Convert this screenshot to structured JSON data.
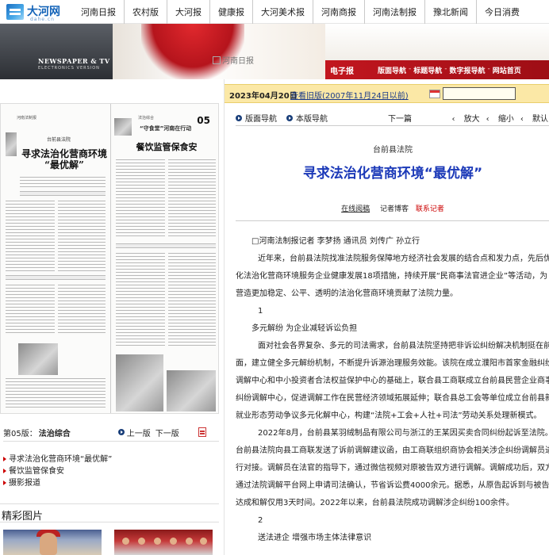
{
  "logo": {
    "name": "大河网",
    "sub": "dahe.cn"
  },
  "nav": [
    "河南日报",
    "农村版",
    "大河报",
    "健康报",
    "大河美术报",
    "河南商报",
    "河南法制报",
    "豫北新闻",
    "今日消费"
  ],
  "banner": {
    "title": "NEWSPAPER & TV",
    "subtitle": "ELECTRONICS VERSION",
    "flash_alt": "河南日报",
    "e_paper_label": "电子报",
    "links": [
      "版面导航",
      "标题导航",
      "数字报导航",
      "网站首页"
    ]
  },
  "paper": {
    "left_header": "河南法制报",
    "left_tag": "台前县法院",
    "left_title_line1": "寻求法治化营商环境",
    "left_title_line2": "“最优解”",
    "right_header": "法治综合",
    "right_num": "05",
    "right_sub": "“守食堂”河南在行动",
    "right_title": "餐饮监管保食安"
  },
  "page_info": {
    "label": "第05版：",
    "section": "法治综合",
    "prev": "上一版",
    "next": "下一版"
  },
  "articles": [
    "寻求法治化营商环境“最优解”",
    "餐饮监管保食安",
    "摄影报道"
  ],
  "photos_heading": "精彩图片",
  "datebar": {
    "date": "2023年04月20日",
    "old_link": "查看旧版(2007年11月24日以前)"
  },
  "article_nav": {
    "layout": "版面导航",
    "section": "本版导航",
    "prev": "下一篇",
    "zoom_in": "放大",
    "zoom_out": "缩小",
    "default": "默认"
  },
  "article": {
    "kicker": "台前县法院",
    "headline": "寻求法治化营商环境“最优解”",
    "byline_online": "在线阅稿",
    "byline_blog": "记者博客",
    "byline_contact": "联系记者",
    "paragraphs": [
      "□河南法制报记者 李梦扬 通讯员 刘传广 孙立行",
      "近年来，台前县法院找准法院服务保障地方经济社会发展的结合点和发力点，先后优化法治化营商环境服务企业健康发展18项措施，持续开展“民商事法官进企业”等活动，为营造更加稳定、公平、透明的法治化营商环境贡献了法院力量。",
      "1",
      "多元解纷 为企业减轻诉讼负担",
      "面对社会各界复杂、多元的司法需求，台前县法院坚持把非诉讼纠纷解决机制挺在前面，建立健全多元解纷机制，不断提升诉源治理服务效能。该院在成立濮阳市首家金融纠纷调解中心和中小投资者合法权益保护中心的基础上，联合县工商联成立台前县民营企业商事纠纷调解中心，促进调解工作在民营经济领域拓展延伸；联合县总工会等单位成立台前县新就业形态劳动争议多元化解中心，构建“法院+工会+人社+司法”劳动关系处理新模式。",
      "2022年8月，台前县某羽绒制品有限公司与浙江的王某因买卖合同纠纷起诉至法院。台前县法院向县工商联发送了诉前调解建议函，由工商联组织商协会相关涉企纠纷调解员进行对接。调解员在法官的指导下，通过微信视频对原被告双方进行调解。调解成功后，双方通过法院调解平台网上申请司法确认，节省诉讼费4000余元。据悉，从原告起诉到与被告达成和解仅用3天时间。2022年以来，台前县法院成功调解涉企纠纷100余件。",
      "2",
      "送法进企 增强市场主体法律意识"
    ]
  }
}
